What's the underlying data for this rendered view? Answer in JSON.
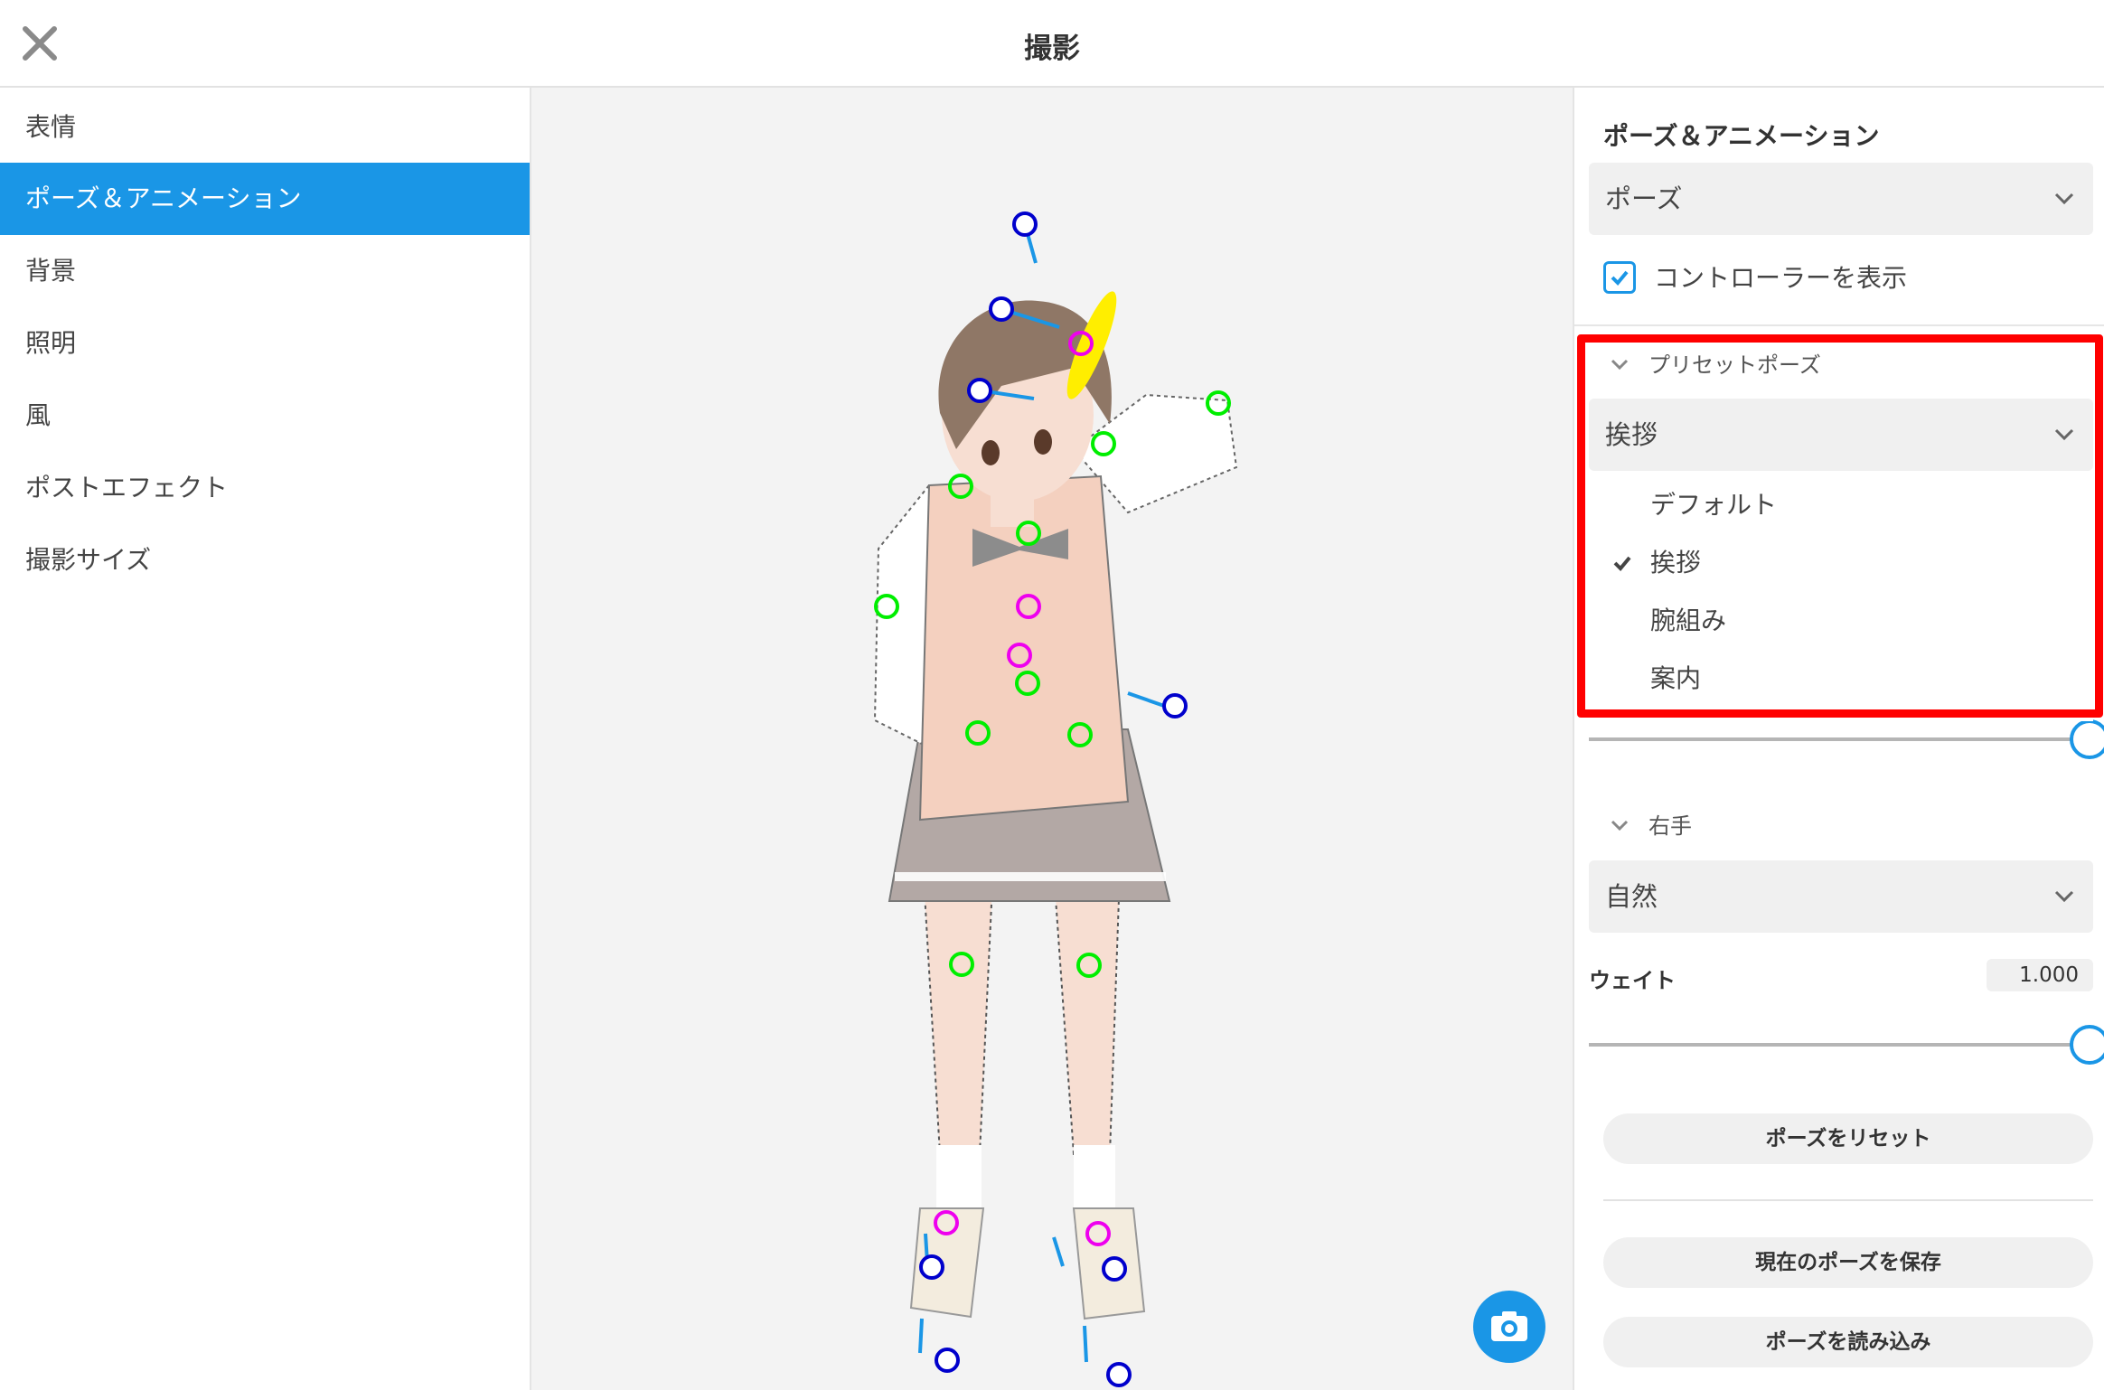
{
  "header": {
    "title": "撮影",
    "close_icon": "close-icon"
  },
  "sidebar": {
    "items": [
      {
        "label": "表情",
        "active": false
      },
      {
        "label": "ポーズ＆アニメーション",
        "active": true
      },
      {
        "label": "背景",
        "active": false
      },
      {
        "label": "照明",
        "active": false
      },
      {
        "label": "風",
        "active": false
      },
      {
        "label": "ポストエフェクト",
        "active": false
      },
      {
        "label": "撮影サイズ",
        "active": false
      }
    ]
  },
  "viewport": {
    "camera_icon": "camera-icon"
  },
  "panel": {
    "heading": "ポーズ＆アニメーション",
    "mode_select": {
      "value": "ポーズ"
    },
    "show_controller": {
      "label": "コントローラーを表示",
      "checked": true
    },
    "preset_pose": {
      "section_label": "プリセットポーズ",
      "selected": "挨拶",
      "options": [
        {
          "label": "デフォルト",
          "checked": false
        },
        {
          "label": "挨拶",
          "checked": true
        },
        {
          "label": "腕組み",
          "checked": false
        },
        {
          "label": "案内",
          "checked": false
        }
      ],
      "weight_level": 1.0
    },
    "right_hand": {
      "section_label": "右手",
      "selected": "自然",
      "weight_label": "ウェイト",
      "weight_value": "1.000",
      "weight_level": 1.0
    },
    "buttons": {
      "reset": "ポーズをリセット",
      "save": "現在のポーズを保存",
      "load": "ポーズを読み込み"
    }
  },
  "colors": {
    "accent": "#1a96e6",
    "highlight": "#ff0000",
    "handle_blue": "#0000cc",
    "handle_green": "#00ee00",
    "handle_magenta": "#ee00ee",
    "handle_yellow": "#ffee00"
  }
}
